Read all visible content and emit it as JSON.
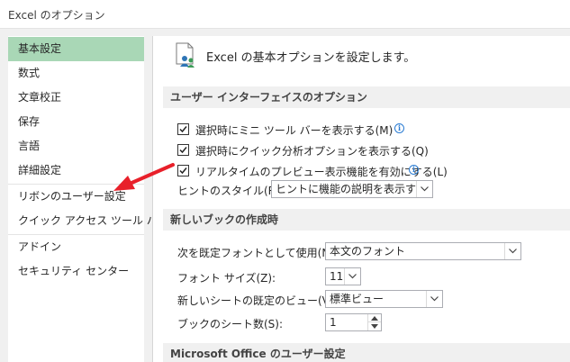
{
  "window": {
    "title": "Excel のオプション"
  },
  "sidebar": {
    "items": [
      {
        "label": "基本設定",
        "selected": true
      },
      {
        "label": "数式"
      },
      {
        "label": "文章校正"
      },
      {
        "label": "保存"
      },
      {
        "label": "言語"
      },
      {
        "label": "詳細設定"
      },
      {
        "label": "リボンのユーザー設定"
      },
      {
        "label": "クイック アクセス ツール バー"
      },
      {
        "label": "アドイン"
      },
      {
        "label": "セキュリティ センター"
      }
    ]
  },
  "content": {
    "header": {
      "text": "Excel の基本オプションを設定します。",
      "icon": "options-settings-icon"
    },
    "ui_section": {
      "title": "ユーザー インターフェイスのオプション",
      "options": [
        {
          "label": "選択時にミニ ツール バーを表示する(M)",
          "checked": true,
          "info": true
        },
        {
          "label": "選択時にクイック分析オプションを表示する(Q)",
          "checked": true,
          "info": false
        },
        {
          "label": "リアルタイムのプレビュー表示機能を有効にする(L)",
          "checked": true,
          "info": true
        }
      ],
      "tip_style": {
        "label": "ヒントのスタイル(R):",
        "value": "ヒントに機能の説明を表示する"
      }
    },
    "new_book_section": {
      "title": "新しいブックの作成時",
      "default_font": {
        "label": "次を既定フォントとして使用(N):",
        "value": "本文のフォント"
      },
      "font_size": {
        "label": "フォント サイズ(Z):",
        "value": "11"
      },
      "default_view": {
        "label": "新しいシートの既定のビュー(V):",
        "value": "標準ビュー"
      },
      "sheet_count": {
        "label": "ブックのシート数(S):",
        "value": "1"
      }
    },
    "office_section": {
      "title": "Microsoft Office のユーザー設定"
    }
  },
  "colors": {
    "selected_nav": "#a9d7b6",
    "annotation_arrow": "#e8202a",
    "info_icon": "#2b7cd3"
  }
}
